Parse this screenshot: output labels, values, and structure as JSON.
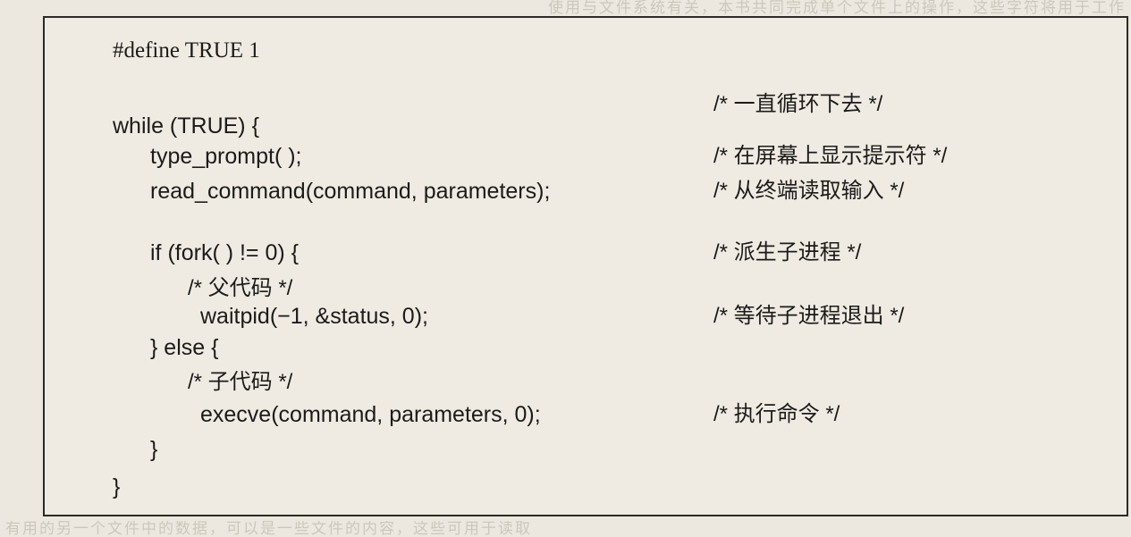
{
  "bleed": {
    "top": "使用与文件系统有关，本书共同完成单个文件上的操作，这些字符将用于工作",
    "bottom": "有用的另一个文件中的数据，可以是一些文件的内容，这些可用于读取"
  },
  "code": {
    "define": "#define TRUE 1",
    "while": "while (TRUE) {",
    "type_prompt": "type_prompt( );",
    "read_command": "read_command(command, parameters);",
    "if_fork": "if (fork( ) != 0) {",
    "parent_comment": "/* 父代码 */",
    "waitpid": "waitpid(−1, &status, 0);",
    "else": "} else {",
    "child_comment": "/* 子代码 */",
    "execve": "execve(command, parameters, 0);",
    "close_inner": "}",
    "close_outer": "}"
  },
  "comments": {
    "loop": "/* 一直循环下去 */",
    "prompt": "/* 在屏幕上显示提示符 */",
    "read": "/* 从终端读取输入 */",
    "fork": "/* 派生子进程 */",
    "wait": "/* 等待子进程退出 */",
    "exec": "/* 执行命令 */"
  }
}
